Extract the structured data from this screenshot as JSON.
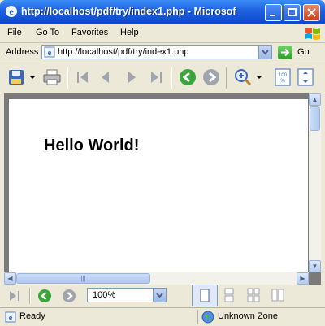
{
  "window": {
    "title": "http://localhost/pdf/try/index1.php - Microsof",
    "title_icon": "ie-icon",
    "controls": [
      "minimize",
      "maximize",
      "close"
    ]
  },
  "menu": {
    "items": [
      "File",
      "Go To",
      "Favorites",
      "Help"
    ]
  },
  "address": {
    "label": "Address",
    "url": "http://localhost/pdf/try/index1.php",
    "go_label": "Go"
  },
  "pdf_toolbar": {
    "tools": [
      "save-icon",
      "save-dropdown-icon",
      "print-icon",
      "first-page-icon",
      "previous-page-icon",
      "next-page-icon",
      "last-page-icon",
      "back-view-icon",
      "forward-view-icon",
      "zoom-in-icon",
      "zoom-dropdown-icon",
      "actual-size-icon",
      "fit-page-icon"
    ]
  },
  "document": {
    "text": "Hello World!"
  },
  "bottom_toolbar": {
    "zoom_value": "100%"
  },
  "status": {
    "text": "Ready",
    "zone": "Unknown Zone"
  }
}
